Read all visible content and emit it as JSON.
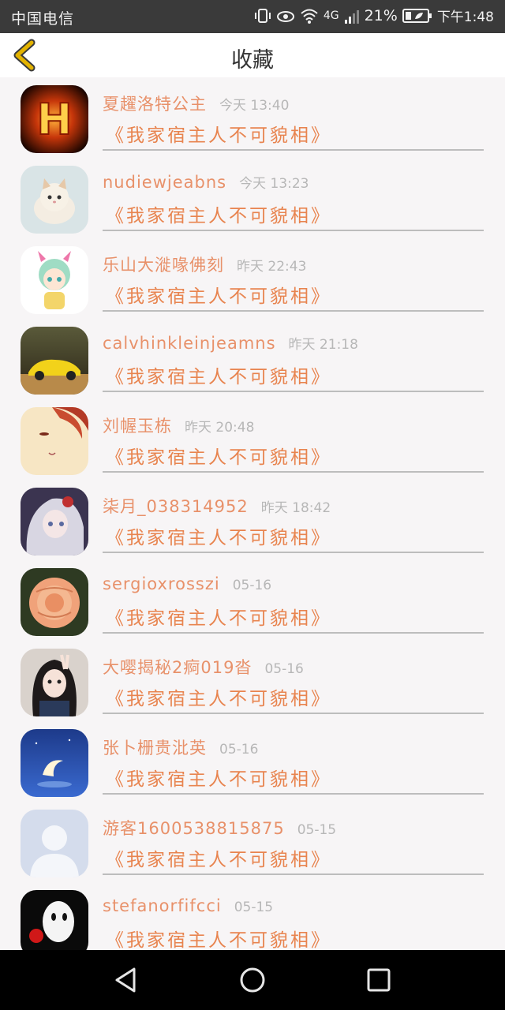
{
  "status_bar": {
    "carrier": "中国电信",
    "network": "4G",
    "battery": "21%",
    "time": "下午1:48"
  },
  "header": {
    "title": "收藏",
    "back_icon": "chevron-left-icon",
    "accent": "#e3b300"
  },
  "favorites": [
    {
      "name": "夏趯洛特公主",
      "time": "今天 13:40",
      "book": "《我家宿主人不可貌相》",
      "avatar": "fire-letter-h"
    },
    {
      "name": "nudiewjeabns",
      "time": "今天 13:23",
      "book": "《我家宿主人不可貌相》",
      "avatar": "kitten"
    },
    {
      "name": "乐山大漇喙佛刻",
      "time": "昨天 22:43",
      "book": "《我家宿主人不可貌相》",
      "avatar": "anime-girl-green"
    },
    {
      "name": "calvhinkleinjeamns",
      "time": "昨天 21:18",
      "book": "《我家宿主人不可貌相》",
      "avatar": "toy-car"
    },
    {
      "name": "刘幄玉栋",
      "time": "昨天 20:48",
      "book": "《我家宿主人不可貌相》",
      "avatar": "red-hair-face"
    },
    {
      "name": "柒月_038314952",
      "time": "昨天 18:42",
      "book": "《我家宿主人不可貌相》",
      "avatar": "anime-silver-hair"
    },
    {
      "name": "sergioxrosszi",
      "time": "05-16",
      "book": "《我家宿主人不可貌相》",
      "avatar": "rose"
    },
    {
      "name": "大嘤揭秘2痾019沓",
      "time": "05-16",
      "book": "《我家宿主人不可貌相》",
      "avatar": "girl-peace-sign"
    },
    {
      "name": "张卜栅贵沘英",
      "time": "05-16",
      "book": "《我家宿主人不可貌相》",
      "avatar": "moon-night"
    },
    {
      "name": "游客1600538815875",
      "time": "05-15",
      "book": "《我家宿主人不可貌相》",
      "avatar": "default-person"
    },
    {
      "name": "stefanorfifcci",
      "time": "05-15",
      "book": "《我家宿主人不可貌相》",
      "avatar": "clown-dark"
    }
  ],
  "nav": {
    "back": "triangle-back-icon",
    "home": "circle-home-icon",
    "recents": "square-recents-icon"
  },
  "colors": {
    "username": "#e8916a",
    "book_title": "#e8844f",
    "time": "#b7b7b7"
  }
}
